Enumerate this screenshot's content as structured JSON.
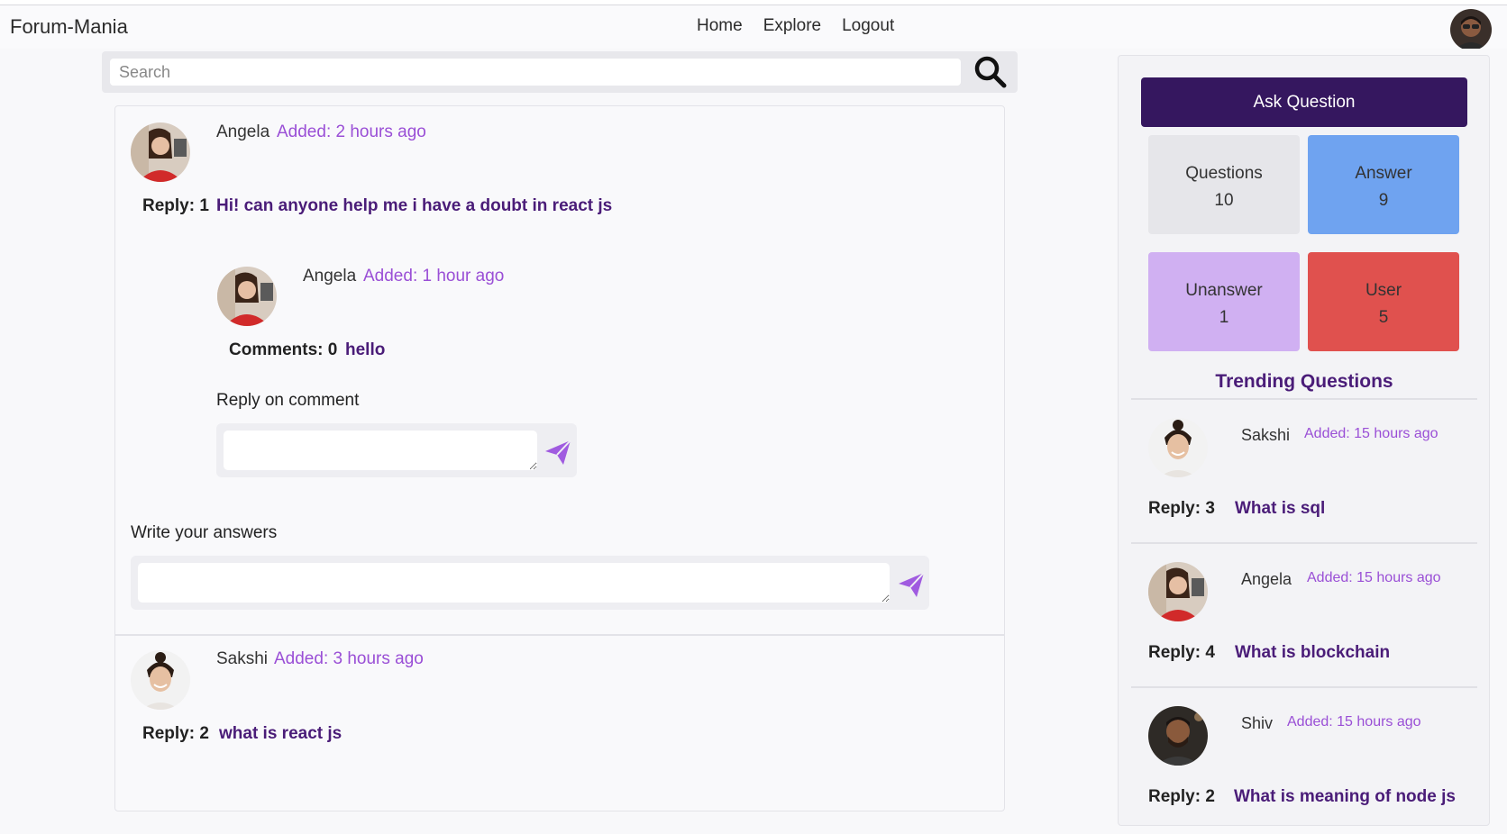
{
  "navbar": {
    "brand": "Forum-Mania",
    "links": [
      "Home",
      "Explore",
      "Logout"
    ]
  },
  "search": {
    "placeholder": "Search",
    "value": ""
  },
  "question": {
    "author": "Angela",
    "added": "Added: 2 hours ago",
    "reply_label": "Reply: 1",
    "title": "Hi! can anyone help me i have a doubt in react js",
    "answer": {
      "author": "Angela",
      "added": "Added: 1 hour ago",
      "comments_label": "Comments: 0",
      "text": "hello",
      "reply_on_comment_label": "Reply on comment"
    },
    "write_answer_label": "Write your answers"
  },
  "question2": {
    "author": "Sakshi",
    "added": "Added: 3 hours ago",
    "reply_label": "Reply: 2",
    "title": "what is react js"
  },
  "sidebar": {
    "ask_button": "Ask Question",
    "stats": [
      {
        "label": "Questions",
        "value": "10",
        "color": "#e6e6ea"
      },
      {
        "label": "Answer",
        "value": "9",
        "color": "#6fa3f0"
      },
      {
        "label": "Unanswer",
        "value": "1",
        "color": "#d0b0f2"
      },
      {
        "label": "User",
        "value": "5",
        "color": "#e0514e"
      }
    ],
    "trending_title": "Trending Questions",
    "trending": [
      {
        "author": "Sakshi",
        "added": "Added: 15 hours ago",
        "reply": "Reply: 3",
        "title": "What is sql"
      },
      {
        "author": "Angela",
        "added": "Added: 15 hours ago",
        "reply": "Reply: 4",
        "title": "What is blockchain"
      },
      {
        "author": "Shiv",
        "added": "Added: 15 hours ago",
        "reply": "Reply: 2",
        "title": "What is meaning of node js"
      }
    ]
  },
  "colors": {
    "brand_dark": "#35175f",
    "title_purple": "#4a1c78",
    "accent_purple": "#9a4fd6"
  }
}
